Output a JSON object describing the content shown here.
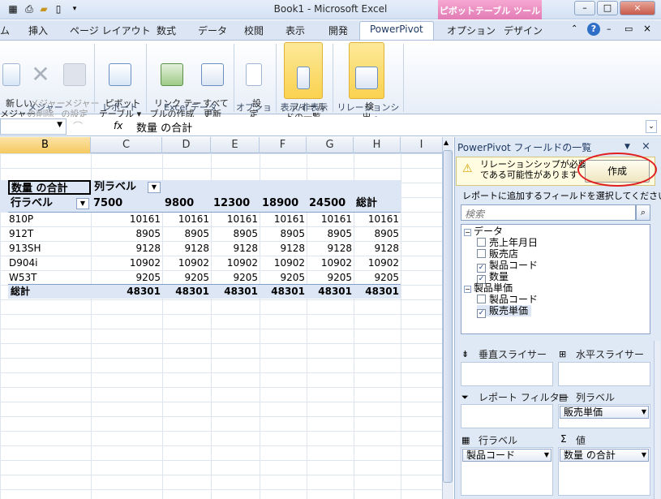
{
  "window": {
    "title": "Book1 - Microsoft Excel",
    "context_tab_group": "ピボットテーブル ツール",
    "buttons": {
      "minimize": "–",
      "restore": "□",
      "close": "×"
    }
  },
  "tabs": [
    "ム",
    "挿入",
    "ページ レイアウト",
    "数式",
    "データ",
    "校閲",
    "表示",
    "開発",
    "PowerPivot",
    "オプション",
    "デザイン"
  ],
  "ribbon": {
    "buttons": [
      {
        "label": "新しい\nメジャー",
        "icon": "new-measure-icon"
      },
      {
        "label": "メジャー\nの削除",
        "icon": "delete-measure-icon"
      },
      {
        "label": "メジャー\nの設定",
        "icon": "measure-settings-icon"
      },
      {
        "label": "ピボット\nテーブル ▾",
        "icon": "pivot-table-icon"
      },
      {
        "label": "リンク テー\nブルの作成",
        "icon": "linked-table-icon"
      },
      {
        "label": "すべて\n更新",
        "icon": "refresh-all-icon"
      },
      {
        "label": "設\n定",
        "icon": "settings-icon"
      },
      {
        "label": "フィール\nドの一覧",
        "icon": "field-list-icon"
      },
      {
        "label": "検\n出",
        "icon": "detect-icon"
      }
    ],
    "groups": [
      "メジャー",
      "レポート",
      "Excel データ",
      "オプション",
      "表示/非表示",
      "リレーションシップ"
    ]
  },
  "formula_bar": {
    "fx": "fx",
    "content": "数量 の合計"
  },
  "columns": [
    "B",
    "C",
    "D",
    "E",
    "F",
    "G",
    "H",
    "I"
  ],
  "pivot": {
    "corner": "数量 の合計",
    "col_label": "列ラベル",
    "row_label": "行ラベル",
    "col_headers": [
      "7500",
      "9800",
      "12300",
      "18900",
      "24500",
      "総計"
    ],
    "rows": [
      {
        "label": "810P",
        "values": [
          "10161",
          "10161",
          "10161",
          "10161",
          "10161",
          "10161"
        ]
      },
      {
        "label": "912T",
        "values": [
          "8905",
          "8905",
          "8905",
          "8905",
          "8905",
          "8905"
        ]
      },
      {
        "label": "913SH",
        "values": [
          "9128",
          "9128",
          "9128",
          "9128",
          "9128",
          "9128"
        ]
      },
      {
        "label": "D904i",
        "values": [
          "10902",
          "10902",
          "10902",
          "10902",
          "10902",
          "10902"
        ]
      },
      {
        "label": "W53T",
        "values": [
          "9205",
          "9205",
          "9205",
          "9205",
          "9205",
          "9205"
        ]
      }
    ],
    "total_row": {
      "label": "総計",
      "values": [
        "48301",
        "48301",
        "48301",
        "48301",
        "48301",
        "48301"
      ]
    }
  },
  "panel": {
    "title": "PowerPivot フィールドの一覧",
    "warning_line1": "リレーションシップが必要",
    "warning_line2": "である可能性があります",
    "create_button": "作成",
    "instruction": "レポートに追加するフィールドを選択してください:",
    "search_placeholder": "検索",
    "tree": [
      {
        "table": "データ",
        "fields": [
          {
            "name": "売上年月日",
            "checked": false
          },
          {
            "name": "販売店",
            "checked": false
          },
          {
            "name": "製品コード",
            "checked": true
          },
          {
            "name": "数量",
            "checked": true
          }
        ]
      },
      {
        "table": "製品単価",
        "fields": [
          {
            "name": "製品コード",
            "checked": false
          },
          {
            "name": "販売単価",
            "checked": true
          }
        ]
      }
    ],
    "zones": {
      "vertical_slicer": "垂直スライサー",
      "horizontal_slicer": "水平スライサー",
      "report_filter": "レポート フィルター",
      "column_labels": "列ラベル",
      "row_labels": "行ラベル",
      "values": "値",
      "column_chip": "販売単価",
      "row_chip": "製品コード",
      "values_chip": "数量 の合計"
    }
  }
}
